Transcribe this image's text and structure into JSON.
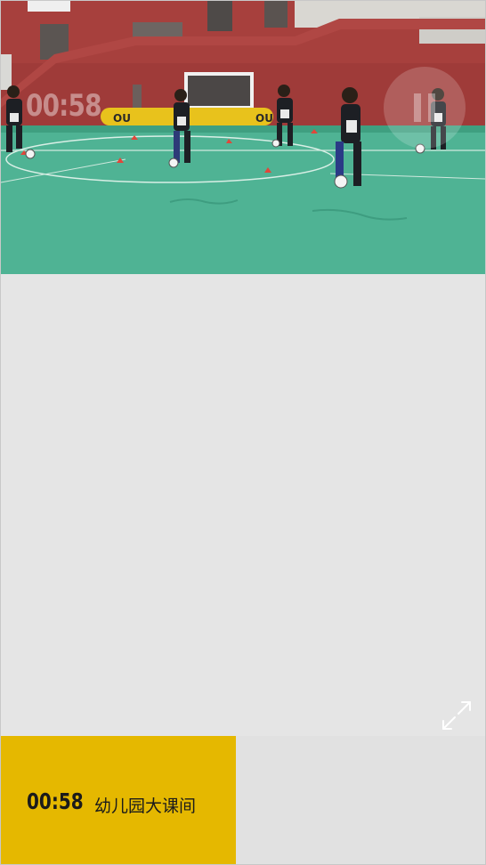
{
  "player": {
    "overlay_time": "00:58",
    "pause_icon": "pause-icon",
    "fullscreen_icon": "expand-icon"
  },
  "video_card": {
    "time": "00:58",
    "title": "幼儿园大课间"
  },
  "colors": {
    "card_background": "#e5b800",
    "page_background": "#e5e5e5",
    "court_green": "#4fb394"
  }
}
